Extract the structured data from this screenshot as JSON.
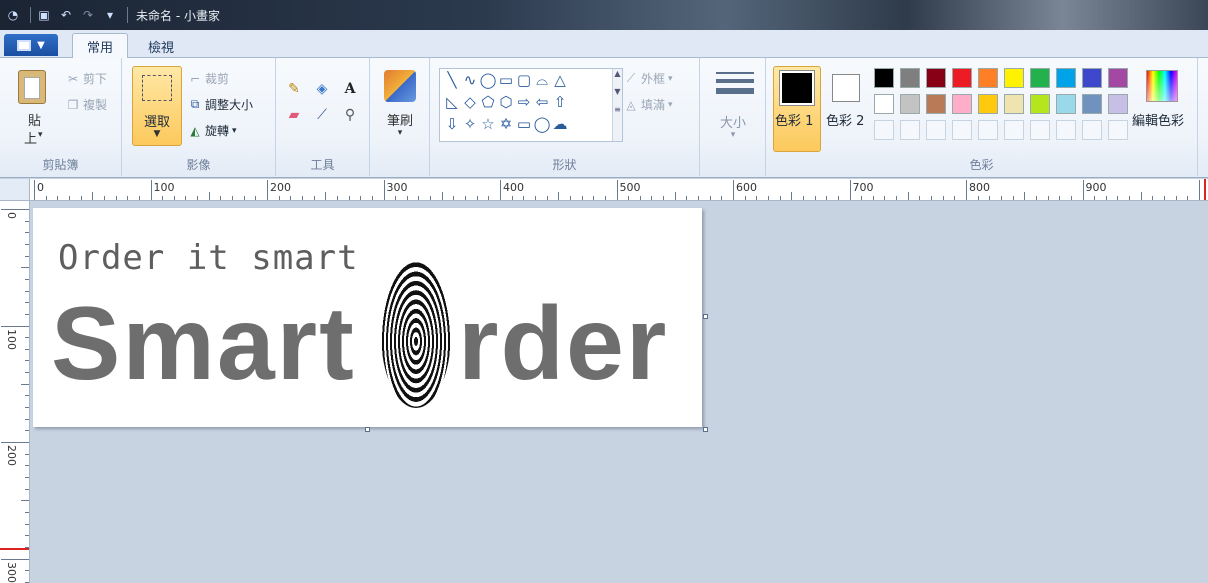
{
  "app": {
    "title": "未命名 - 小畫家"
  },
  "tabs": {
    "home": "常用",
    "view": "檢視"
  },
  "ribbon": {
    "clipboard": {
      "paste_label": "貼",
      "paste_label2": "上",
      "cut": "剪下",
      "copy": "複製",
      "group": "剪貼簿"
    },
    "image": {
      "select": "選取",
      "crop": "裁剪",
      "resize": "調整大小",
      "rotate": "旋轉",
      "group": "影像"
    },
    "tools": {
      "group": "工具",
      "text_glyph": "A"
    },
    "brushes": {
      "label": "筆刷"
    },
    "shapes": {
      "outline": "外框",
      "fill": "填滿",
      "group": "形狀"
    },
    "size": {
      "label": "大小"
    },
    "colors": {
      "color1": "色彩 1",
      "color2": "色彩 2",
      "edit": "編輯色彩",
      "group": "色彩",
      "palette_row1": [
        "#000000",
        "#7f7f7f",
        "#880015",
        "#ed1c24",
        "#ff7f27",
        "#fff200",
        "#22b14c",
        "#00a2e8",
        "#3f48cc",
        "#a349a4"
      ],
      "palette_row2": [
        "#ffffff",
        "#c3c3c3",
        "#b97a57",
        "#ffaec9",
        "#ffc90e",
        "#efe4b0",
        "#b5e61d",
        "#99d9ea",
        "#7092be",
        "#c8bfe7"
      ]
    }
  },
  "ruler": {
    "h_labels": [
      "0",
      "100",
      "200",
      "300",
      "400",
      "500",
      "600",
      "700",
      "800",
      "900"
    ],
    "v_labels": [
      "0",
      "100",
      "200",
      "300"
    ]
  },
  "canvas": {
    "tagline": "Order it smart",
    "brand_left": "Smart",
    "brand_right": "rder"
  }
}
